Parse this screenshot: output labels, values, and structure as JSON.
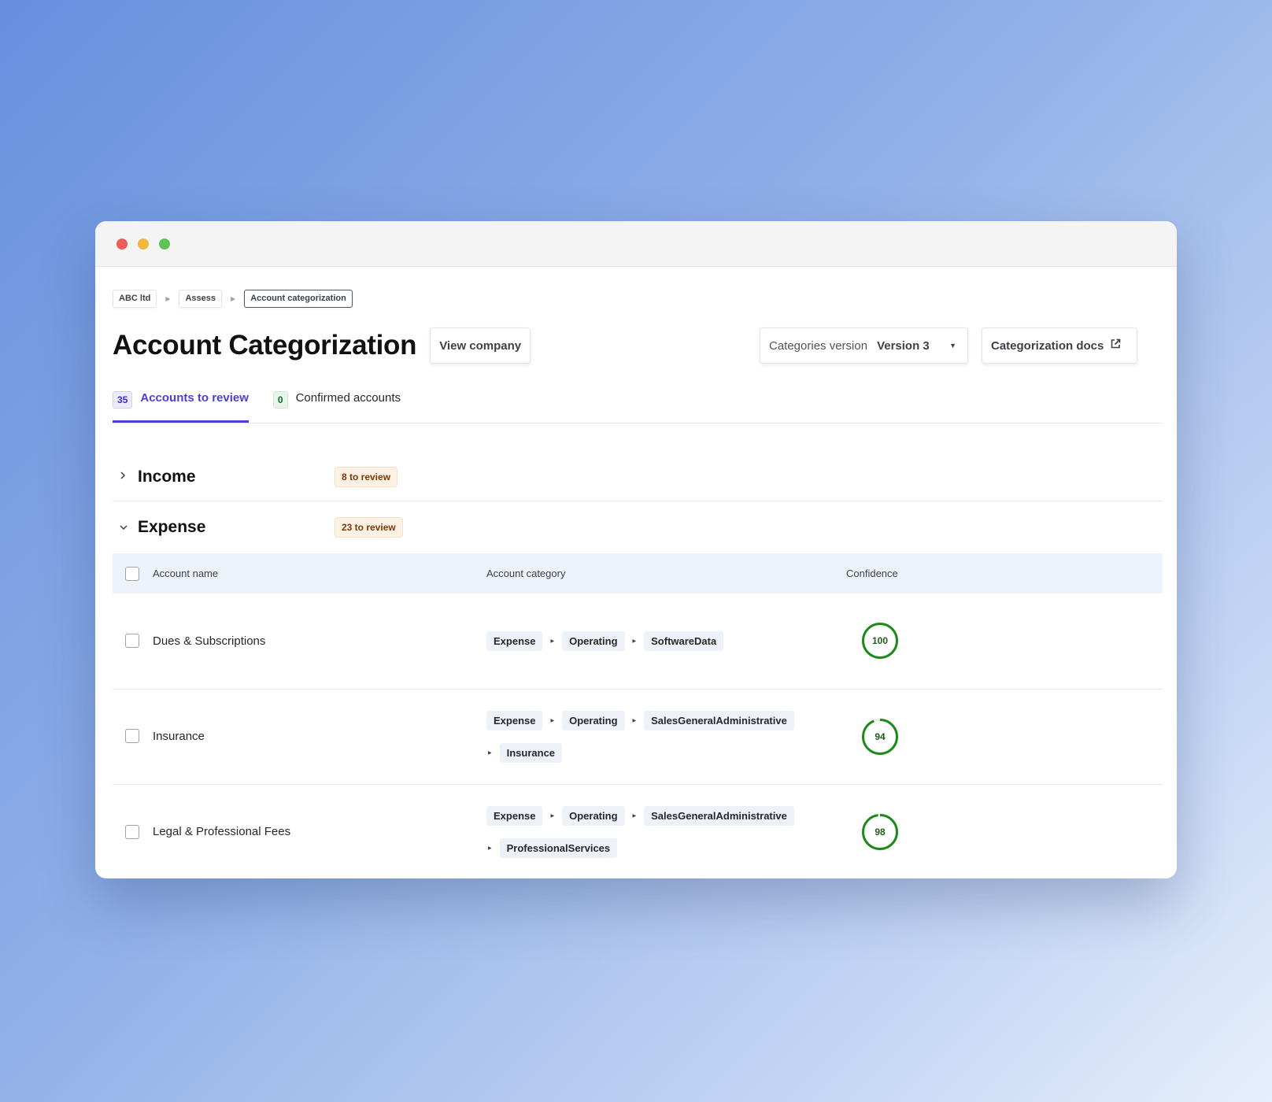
{
  "window": {
    "traffic_lights": [
      {
        "name": "close",
        "color": "#ec5e57"
      },
      {
        "name": "minimize",
        "color": "#f2b73b"
      },
      {
        "name": "zoom",
        "color": "#5ec254"
      }
    ]
  },
  "breadcrumb": {
    "items": [
      "ABC ltd",
      "Assess",
      "Account categorization"
    ],
    "separator_icon": "chevron-right-icon"
  },
  "header": {
    "title": "Account Categorization",
    "view_company_label": "View company",
    "version_label": "Categories version",
    "version_value": "Version 3",
    "version_caret_icon": "caret-down-icon",
    "docs_label": "Categorization docs",
    "docs_icon": "external-link-icon"
  },
  "tabs": [
    {
      "count": "35",
      "label": "Accounts to review",
      "active": true
    },
    {
      "count": "0",
      "label": "Confirmed accounts",
      "active": false
    }
  ],
  "income": {
    "title": "Income",
    "badge": "8 to review",
    "expanded": false
  },
  "expense": {
    "title": "Expense",
    "badge": "23 to review",
    "expanded": true,
    "columns": {
      "name": "Account name",
      "category": "Account category",
      "confidence": "Confidence"
    },
    "rows": [
      {
        "name": "Dues & Subscriptions",
        "path": [
          "Expense",
          "Operating",
          "SoftwareData"
        ],
        "confidence": 100
      },
      {
        "name": "Insurance",
        "path": [
          "Expense",
          "Operating",
          "SalesGeneralAdministrative",
          "Insurance"
        ],
        "confidence": 94
      },
      {
        "name": "Legal & Professional Fees",
        "path": [
          "Expense",
          "Operating",
          "SalesGeneralAdministrative",
          "ProfessionalServices"
        ],
        "confidence": 98
      }
    ]
  },
  "colors": {
    "accent": "#4c3fd1",
    "confidence_ring": "#1f8a1b",
    "review_badge_bg": "#fdf1e3"
  }
}
